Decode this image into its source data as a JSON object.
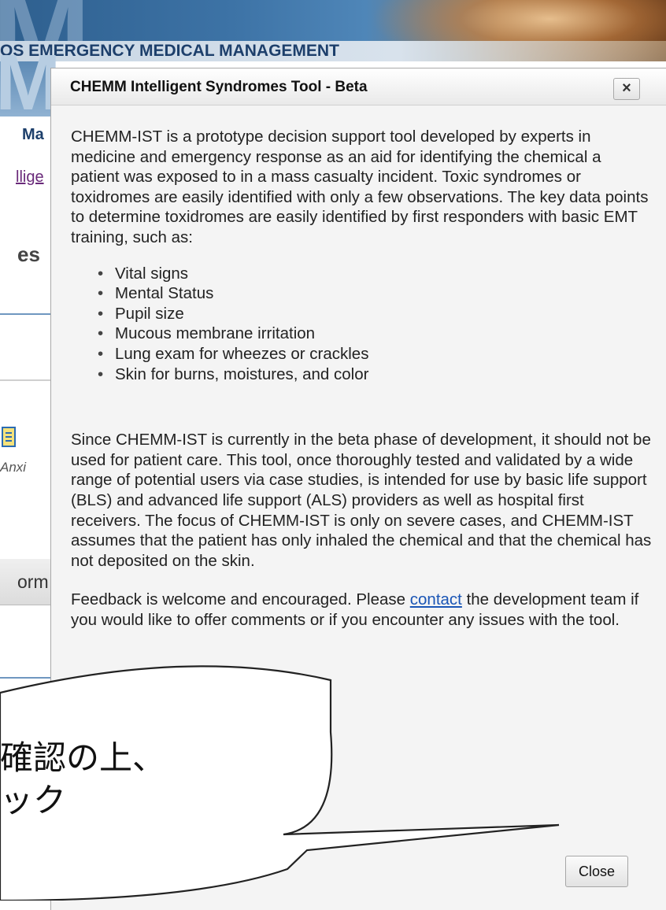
{
  "site": {
    "title": "OS EMERGENCY MEDICAL MANAGEMENT"
  },
  "background_fragments": {
    "nav_partial": "Ma",
    "link_partial": "llige",
    "heading_partial": "es",
    "caption_partial": "Anxi",
    "table_header_partial": "orm"
  },
  "dialog": {
    "title": "CHEMM Intelligent Syndromes Tool - Beta",
    "close_x_label": "×",
    "intro": "CHEMM-IST is a prototype decision support tool developed by experts in medicine and emergency response as an aid for identifying the chemical a patient was exposed to in a mass casualty incident. Toxic syndromes or toxidromes are easily identified with only a few observations. The key data points to determine toxidromes are easily identified by first responders with basic EMT training, such as:",
    "bullets": [
      "Vital signs",
      "Mental Status",
      "Pupil size",
      "Mucous membrane irritation",
      "Lung exam for wheezes or crackles",
      "Skin for burns, moistures, and color"
    ],
    "beta_notice": "Since CHEMM-IST is currently in the beta phase of development, it should not be used for patient care. This tool, once thoroughly tested and validated by a wide range of potential users via case studies, is intended for use by basic life support (BLS) and advanced life support (ALS) providers as well as hospital first receivers. The focus of CHEMM-IST is only on severe cases, and CHEMM-IST assumes that the patient has only inhaled the chemical and that the chemical has not deposited on the skin.",
    "feedback_before": "Feedback is welcome and encouraged. Please ",
    "feedback_link": "contact",
    "feedback_after": " the development team if you would like to offer comments or if you encounter any issues with the tool.",
    "close_button_label": "Close"
  },
  "callout": {
    "text": "確認の上、\nック"
  }
}
